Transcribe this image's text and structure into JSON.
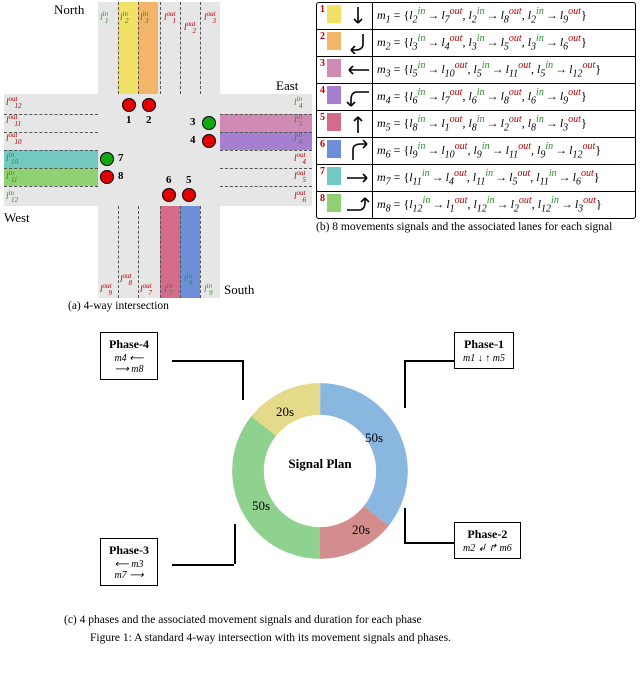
{
  "dir": {
    "north": "North",
    "south": "South",
    "east": "East",
    "west": "West"
  },
  "laneLabels": {
    "l1in": "l1in",
    "l2in": "l2in",
    "l3in": "l3in",
    "l1out": "l1out",
    "l2out": "l2out",
    "l3out": "l3out",
    "l4in": "l4in",
    "l5in": "l5in",
    "l6in": "l6in",
    "l4out": "l4out",
    "l5out": "l5out",
    "l6out": "l6out",
    "l7in": "l7in",
    "l8in": "l8in",
    "l9in": "l9in",
    "l7out": "l7out",
    "l8out": "l8out",
    "l9out": "l9out",
    "l10in": "l10in",
    "l11in": "l11in",
    "l12in": "l12in",
    "l10out": "l10out",
    "l11out": "l11out",
    "l12out": "l12out"
  },
  "signals": {
    "1": {
      "color": "red"
    },
    "2": {
      "color": "red"
    },
    "3": {
      "color": "green"
    },
    "4": {
      "color": "red"
    },
    "5": {
      "color": "red"
    },
    "6": {
      "color": "red"
    },
    "7": {
      "color": "green"
    },
    "8": {
      "color": "red"
    }
  },
  "legend": {
    "rows": [
      {
        "n": "1",
        "swatch": "#f2e169",
        "arrow": "down",
        "m": "m1",
        "body": "m₁ = {l₂ⁱⁿ → l₇ᵒᵘᵗ, l₂ⁱⁿ → l₈ᵒᵘᵗ, l₂ⁱⁿ → l₉ᵒᵘᵗ}"
      },
      {
        "n": "2",
        "swatch": "#f3b569",
        "arrow": "down-left",
        "m": "m2",
        "body": "m₂ = {l₃ⁱⁿ → l₄ᵒᵘᵗ, l₃ⁱⁿ → l₅ᵒᵘᵗ, l₃ⁱⁿ → l₆ᵒᵘᵗ}"
      },
      {
        "n": "3",
        "swatch": "#cf8bb3",
        "arrow": "left",
        "m": "m3",
        "body": "m₃ = {l₅ⁱⁿ → l₁₀ᵒᵘᵗ, l₅ⁱⁿ → l₁₁ᵒᵘᵗ, l₅ⁱⁿ → l₁₂ᵒᵘᵗ}"
      },
      {
        "n": "4",
        "swatch": "#a67fd0",
        "arrow": "left-down",
        "m": "m4",
        "body": "m₄ = {l₆ⁱⁿ → l₇ᵒᵘᵗ, l₆ⁱⁿ → l₈ᵒᵘᵗ, l₆ⁱⁿ → l₉ᵒᵘᵗ}"
      },
      {
        "n": "5",
        "swatch": "#d56b8a",
        "arrow": "up",
        "m": "m5",
        "body": "m₅ = {l₈ⁱⁿ → l₁ᵒᵘᵗ, l₈ⁱⁿ → l₂ᵒᵘᵗ, l₈ⁱⁿ → l₃ᵒᵘᵗ}"
      },
      {
        "n": "6",
        "swatch": "#6c8fd8",
        "arrow": "up-right",
        "m": "m6",
        "body": "m₆ = {l₉ⁱⁿ → l₁₀ᵒᵘᵗ, l₉ⁱⁿ → l₁₁ᵒᵘᵗ, l₉ⁱⁿ → l₁₂ᵒᵘᵗ}"
      },
      {
        "n": "7",
        "swatch": "#74c8c2",
        "arrow": "right",
        "m": "m7",
        "body": "m₇ = {l₁₁ⁱⁿ → l₄ᵒᵘᵗ, l₁₁ⁱⁿ → l₅ᵒᵘᵗ, l₁₁ⁱⁿ → l₆ᵒᵘᵗ}"
      },
      {
        "n": "8",
        "swatch": "#8fd173",
        "arrow": "right-up",
        "m": "m8",
        "body": "m₈ = {l₁₂ⁱⁿ → l₁ᵒᵘᵗ, l₁₂ⁱⁿ → l₂ᵒᵘᵗ, l₁₂ⁱⁿ → l₃ᵒᵘᵗ}"
      }
    ]
  },
  "caption_a": "(a) 4-way intersection",
  "caption_b": "(b) 8 movements signals and the associated lanes for each signal",
  "caption_c": "(c) 4 phases and the associated movement signals and duration for each phase",
  "figure_caption": "Figure 1: A standard 4-way intersection with its movement signals and phases.",
  "plan": {
    "center_label": "Signal Plan",
    "phases": [
      {
        "title": "Phase-1",
        "line1": "m1",
        "line2": "m5"
      },
      {
        "title": "Phase-2",
        "line1": "m2",
        "line2": "m6"
      },
      {
        "title": "Phase-3",
        "line1": "m3",
        "line2": "m7"
      },
      {
        "title": "Phase-4",
        "line1": "m4",
        "line2": "m8"
      }
    ],
    "segments": [
      {
        "label": "50s",
        "color": "#8ab7e0"
      },
      {
        "label": "20s",
        "color": "#d48d8d"
      },
      {
        "label": "50s",
        "color": "#8fd18f"
      },
      {
        "label": "20s",
        "color": "#e5d98a"
      }
    ]
  },
  "chart_data": {
    "type": "pie",
    "title": "Signal Plan",
    "categories": [
      "Phase-1",
      "Phase-2",
      "Phase-3",
      "Phase-4"
    ],
    "values": [
      50,
      20,
      50,
      20
    ],
    "series": [
      {
        "name": "duration (s)",
        "values": [
          50,
          20,
          50,
          20
        ]
      }
    ],
    "colors": [
      "#8ab7e0",
      "#d48d8d",
      "#8fd18f",
      "#e5d98a"
    ],
    "phase_movements": [
      [
        "m1",
        "m5"
      ],
      [
        "m2",
        "m6"
      ],
      [
        "m3",
        "m7"
      ],
      [
        "m4",
        "m8"
      ]
    ]
  }
}
